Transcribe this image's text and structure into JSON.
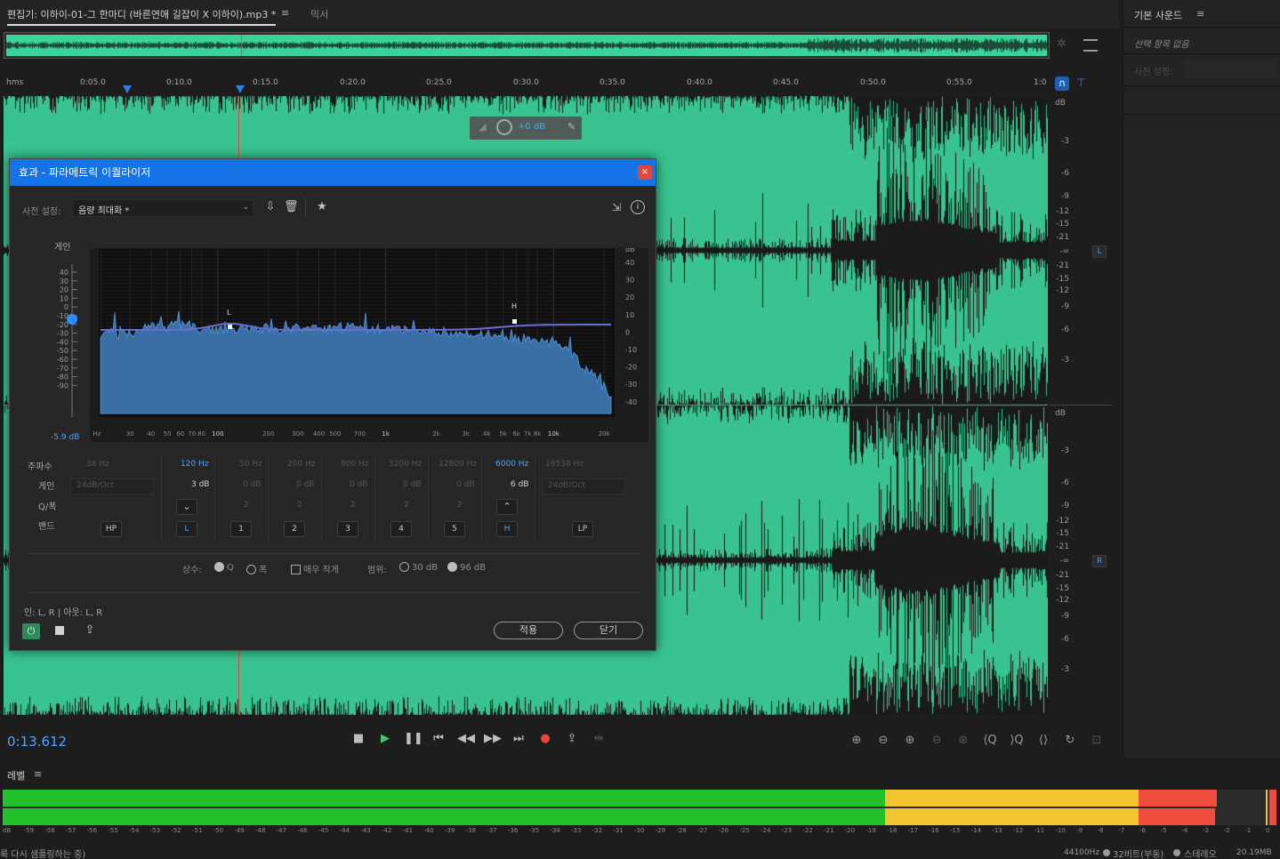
{
  "tabs": {
    "editor_tab": "편집기: 이하이-01-그 한마디 (바른연애 길잡이 X 이하이).mp3 *",
    "menu_icon": "≡",
    "mixer_tab": "믹서"
  },
  "right_panel": {
    "title": "기본 사운드",
    "menu_icon": "≡",
    "no_selection": "선택 항목 없음",
    "preset_label": "사전 설정:"
  },
  "ruler": {
    "unit": "hms",
    "ticks": [
      "0:05.0",
      "0:10.0",
      "0:15.0",
      "0:20.0",
      "0:25.0",
      "0:30.0",
      "0:35.0",
      "0:40.0",
      "0:45.0",
      "0:50.0",
      "0:55.0",
      "1:0"
    ]
  },
  "hud": {
    "value": "+0 dB"
  },
  "db_scale": {
    "unit": "dB",
    "labels": [
      "-3",
      "-6",
      "-9",
      "-12",
      "-15",
      "-21",
      "-∞",
      "-21",
      "-15",
      "-12",
      "-9",
      "-6",
      "-3"
    ],
    "channels": [
      "L",
      "R"
    ]
  },
  "dialog": {
    "title": "효과 - 파라메트릭 이퀄라이저",
    "close": "×",
    "preset_label": "사전 설정:",
    "preset_value": "음량 최대화 *",
    "gain_label": "게인",
    "gain_value": "-5.9 dB",
    "left_scale": [
      "40",
      "30",
      "20",
      "10",
      "0",
      "-10",
      "-20",
      "-30",
      "-40",
      "-50",
      "-60",
      "-70",
      "-80",
      "-90"
    ],
    "right_scale": [
      "dB",
      "40",
      "30",
      "20",
      "10",
      "0",
      "-10",
      "-20",
      "-30",
      "-40"
    ],
    "freq_axis": [
      "Hz",
      "30",
      "40",
      "50",
      "60",
      "70",
      "80",
      "100",
      "200",
      "300",
      "400",
      "500",
      "700",
      "1k",
      "2k",
      "3k",
      "4k",
      "5k",
      "6k",
      "7k",
      "8k",
      "10k",
      "20k"
    ],
    "marker_l": "L",
    "marker_h": "H",
    "row_labels": {
      "freq": "주파수",
      "gain": "게인",
      "q": "Q/폭",
      "band": "밴드"
    },
    "bands": [
      {
        "freq": "38 Hz",
        "gain": "24dB/Oct",
        "q": "",
        "btn": "HP",
        "active": false
      },
      {
        "freq": "120 Hz",
        "gain": "3 dB",
        "q": "shelf-low",
        "btn": "L",
        "active": true
      },
      {
        "freq": "50 Hz",
        "gain": "0 dB",
        "q": "2",
        "btn": "1",
        "active": false
      },
      {
        "freq": "200 Hz",
        "gain": "0 dB",
        "q": "2",
        "btn": "2",
        "active": false
      },
      {
        "freq": "800 Hz",
        "gain": "0 dB",
        "q": "2",
        "btn": "3",
        "active": false
      },
      {
        "freq": "3200 Hz",
        "gain": "0 dB",
        "q": "2",
        "btn": "4",
        "active": false
      },
      {
        "freq": "12800 Hz",
        "gain": "0 dB",
        "q": "2",
        "btn": "5",
        "active": false
      },
      {
        "freq": "6000 Hz",
        "gain": "6 dB",
        "q": "shelf-high",
        "btn": "H",
        "active": true
      },
      {
        "freq": "16538 Hz",
        "gain": "24dB/Oct",
        "q": "",
        "btn": "LP",
        "active": false
      }
    ],
    "constant_label": "상수:",
    "constant_q": "Q",
    "constant_width": "폭",
    "ultra_quiet": "매우 작게",
    "range_label": "범위:",
    "range_30": "30 dB",
    "range_96": "96 dB",
    "io": "인: L, R | 아웃: L, R",
    "apply": "적용",
    "close_btn": "닫기"
  },
  "transport": {
    "time": "0:13.612"
  },
  "levels": {
    "title": "레벨",
    "menu_icon": "≡",
    "scale": [
      "dB",
      "-59",
      "-58",
      "-57",
      "-56",
      "-55",
      "-54",
      "-53",
      "-52",
      "-51",
      "-50",
      "-49",
      "-48",
      "-47",
      "-46",
      "-45",
      "-44",
      "-43",
      "-42",
      "-41",
      "-40",
      "-39",
      "-38",
      "-37",
      "-36",
      "-35",
      "-34",
      "-33",
      "-32",
      "-31",
      "-30",
      "-29",
      "-28",
      "-27",
      "-26",
      "-25",
      "-24",
      "-23",
      "-22",
      "-21",
      "-20",
      "-19",
      "-18",
      "-17",
      "-16",
      "-15",
      "-14",
      "-13",
      "-12",
      "-11",
      "-10",
      "-9",
      "-8",
      "-7",
      "-6",
      "-5",
      "-4",
      "-3",
      "-2",
      "-1",
      "0"
    ]
  },
  "status": {
    "left": "룩 다시 샘플링하는 중)",
    "sample_rate": "44100Hz",
    "bit_depth": "32비트(부동)",
    "channels": "스테레오",
    "size": "20.19MB"
  },
  "colors": {
    "wave_bg": "#38c38f",
    "accent": "#1473e6",
    "eq_fill": "#3a6fa5"
  }
}
